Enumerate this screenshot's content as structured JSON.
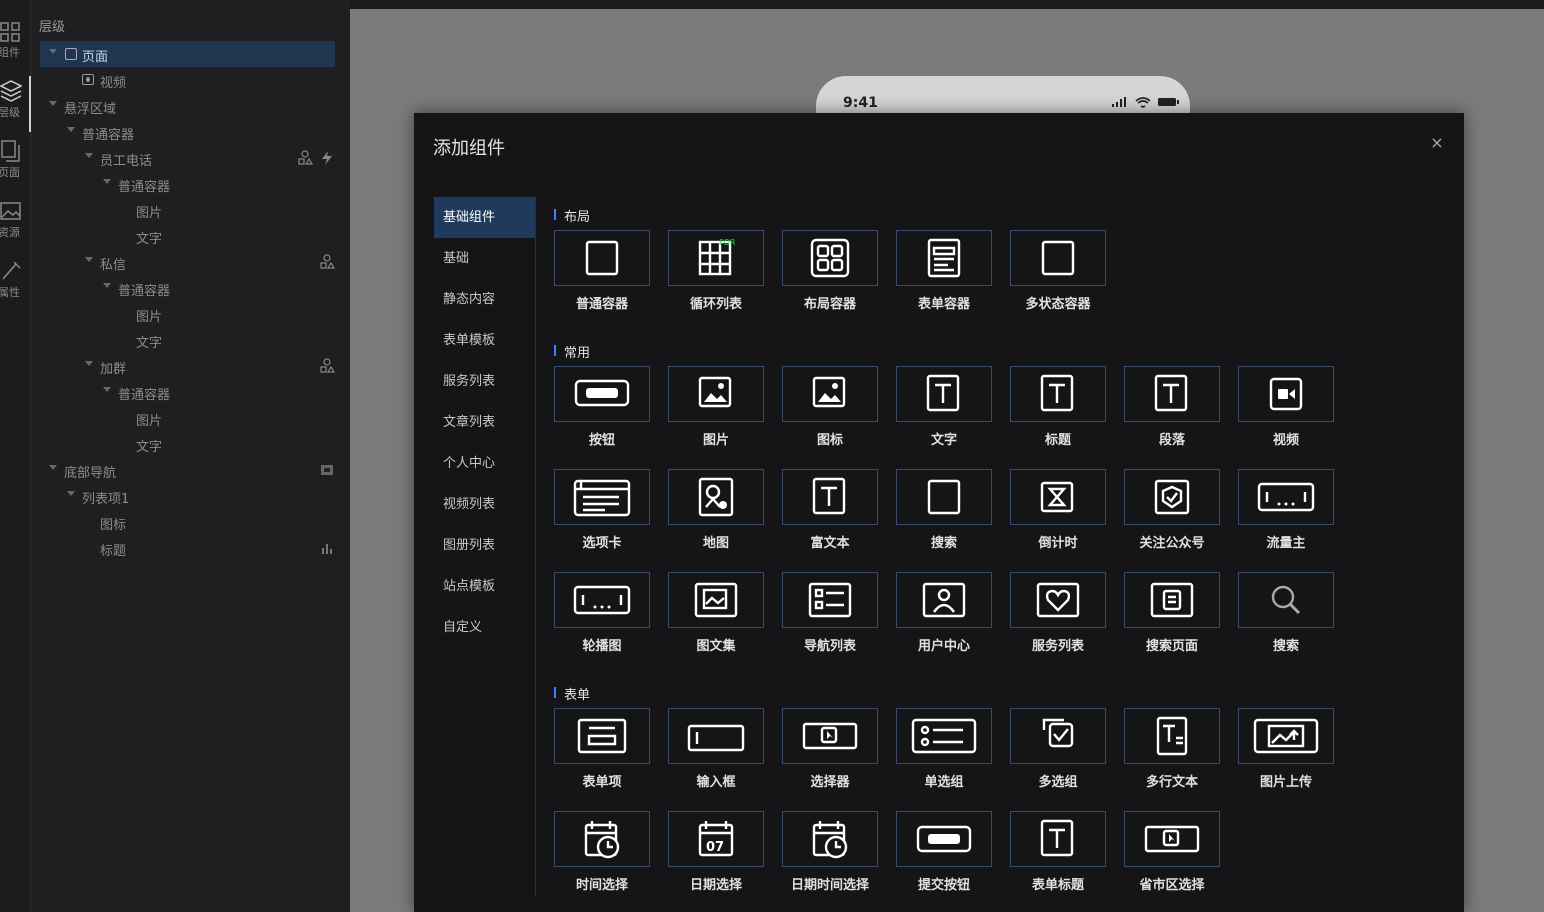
{
  "rail": [
    {
      "label": "组件",
      "icon": "grid-icon"
    },
    {
      "label": "层级",
      "icon": "layers-icon"
    },
    {
      "label": "页面",
      "icon": "page-icon"
    },
    {
      "label": "资源",
      "icon": "image-icon"
    },
    {
      "label": "属性",
      "icon": "brush-icon"
    }
  ],
  "tree": {
    "header": "层级",
    "nodes": [
      {
        "label": "页面"
      },
      {
        "label": "视频"
      },
      {
        "label": "悬浮区域"
      },
      {
        "label": "普通容器"
      },
      {
        "label": "员工电话"
      },
      {
        "label": "普通容器"
      },
      {
        "label": "图片"
      },
      {
        "label": "文字"
      },
      {
        "label": "私信"
      },
      {
        "label": "普通容器"
      },
      {
        "label": "图片"
      },
      {
        "label": "文字"
      },
      {
        "label": "加群"
      },
      {
        "label": "普通容器"
      },
      {
        "label": "图片"
      },
      {
        "label": "文字"
      },
      {
        "label": "底部导航"
      },
      {
        "label": "列表项1"
      },
      {
        "label": "图标"
      },
      {
        "label": "标题"
      }
    ]
  },
  "phone": {
    "time": "9:41"
  },
  "modal": {
    "title": "添加组件",
    "close": "×",
    "categories": [
      "基础组件",
      "基础",
      "静态内容",
      "表单模板",
      "服务列表",
      "文章列表",
      "个人中心",
      "视频列表",
      "图册列表",
      "站点模板",
      "自定义"
    ],
    "sections": {
      "layout": {
        "title": "布局",
        "items": [
          "普通容器",
          "循环列表",
          "布局容器",
          "表单容器",
          "多状态容器"
        ]
      },
      "common": {
        "title": "常用",
        "items": [
          "按钮",
          "图片",
          "图标",
          "文字",
          "标题",
          "段落",
          "视频",
          "选项卡",
          "地图",
          "富文本",
          "搜索",
          "倒计时",
          "关注公众号",
          "流量主",
          "轮播图",
          "图文集",
          "导航列表",
          "用户中心",
          "服务列表",
          "搜索页面",
          "搜索"
        ]
      },
      "form": {
        "title": "表单",
        "items": [
          "表单项",
          "输入框",
          "选择器",
          "单选组",
          "多选组",
          "多行文本",
          "图片上传",
          "时间选择",
          "日期选择",
          "日期时间选择",
          "提交按钮",
          "表单标题",
          "省市区选择"
        ]
      }
    },
    "for_badge": "FOR"
  },
  "colors": {
    "accent": "#3d7fff",
    "selected_bg": "#1f3a5c",
    "tile_border": "#3a4b6b",
    "arrow": "#e8231f"
  }
}
